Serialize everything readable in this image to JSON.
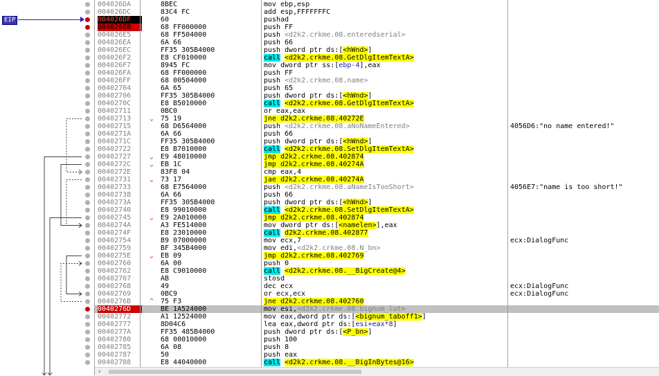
{
  "eip_label": "EIP",
  "scroll_left_icon": "‹",
  "rows": [
    {
      "addr": "004026DA",
      "bytes": "8BEC",
      "instr": [
        {
          "t": "mov ebp,esp"
        }
      ],
      "comment": ""
    },
    {
      "addr": "004026DC",
      "bytes": "83C4 FC",
      "instr": [
        {
          "t": "add esp,FFFFFFFC"
        }
      ],
      "comment": ""
    },
    {
      "addr": "004026DF",
      "bytes": "60",
      "instr": [
        {
          "t": "pushad"
        }
      ],
      "comment": "",
      "mark": "eip"
    },
    {
      "addr": "004026E0",
      "bytes": "68 FF000000",
      "instr": [
        {
          "t": "push FF"
        }
      ],
      "comment": "",
      "mark": "bp"
    },
    {
      "addr": "004026E5",
      "bytes": "68 FF504000",
      "instr": [
        {
          "t": "push "
        },
        {
          "t": "<d2k2.crkme.08.enteredserial>",
          "c": "gray"
        }
      ],
      "comment": ""
    },
    {
      "addr": "004026EA",
      "bytes": "6A 66",
      "instr": [
        {
          "t": "push 66"
        }
      ],
      "comment": ""
    },
    {
      "addr": "004026EC",
      "bytes": "FF35 305B4000",
      "instr": [
        {
          "t": "push dword ptr ds:["
        },
        {
          "t": "<hWnd>",
          "c": "yellow"
        },
        {
          "t": "]"
        }
      ],
      "comment": ""
    },
    {
      "addr": "004026F2",
      "bytes": "E8 CF010000",
      "instr": [
        {
          "t": "call",
          "c": "cyan"
        },
        {
          "t": " "
        },
        {
          "t": "<d2k2.crkme.08.GetDlgItemTextA>",
          "c": "yellow"
        }
      ],
      "comment": ""
    },
    {
      "addr": "004026F7",
      "bytes": "8945 FC",
      "instr": [
        {
          "t": "mov dword ptr ss:["
        },
        {
          "t": "ebp-4",
          "c": "blue"
        },
        {
          "t": "],eax"
        }
      ],
      "comment": ""
    },
    {
      "addr": "004026FA",
      "bytes": "68 FF000000",
      "instr": [
        {
          "t": "push FF"
        }
      ],
      "comment": ""
    },
    {
      "addr": "004026FF",
      "bytes": "68 00504000",
      "instr": [
        {
          "t": "push "
        },
        {
          "t": "<d2k2.crkme.08.name>",
          "c": "gray"
        }
      ],
      "comment": ""
    },
    {
      "addr": "00402704",
      "bytes": "6A 65",
      "instr": [
        {
          "t": "push 65"
        }
      ],
      "comment": ""
    },
    {
      "addr": "00402706",
      "bytes": "FF35 305B4000",
      "instr": [
        {
          "t": "push dword ptr ds:["
        },
        {
          "t": "<hWnd>",
          "c": "yellow"
        },
        {
          "t": "]"
        }
      ],
      "comment": ""
    },
    {
      "addr": "0040270C",
      "bytes": "E8 B5010000",
      "instr": [
        {
          "t": "call",
          "c": "cyan"
        },
        {
          "t": " "
        },
        {
          "t": "<d2k2.crkme.08.GetDlgItemTextA>",
          "c": "yellow"
        }
      ],
      "comment": ""
    },
    {
      "addr": "00402711",
      "bytes": "0BC0",
      "instr": [
        {
          "t": "or eax,eax"
        }
      ],
      "comment": ""
    },
    {
      "addr": "00402713",
      "bytes": "75 19",
      "instr": [
        {
          "t": "jne d2k2.crkme.08.40272E",
          "c": "yellow"
        }
      ],
      "comment": "",
      "arrow": "⌄"
    },
    {
      "addr": "00402715",
      "bytes": "68 D6564000",
      "instr": [
        {
          "t": "push "
        },
        {
          "t": "<d2k2.crkme.08.aNoNameEntered>",
          "c": "gray"
        }
      ],
      "comment": "4056D6:\"no name entered!\""
    },
    {
      "addr": "0040271A",
      "bytes": "6A 66",
      "instr": [
        {
          "t": "push 66"
        }
      ],
      "comment": ""
    },
    {
      "addr": "0040271C",
      "bytes": "FF35 305B4000",
      "instr": [
        {
          "t": "push dword ptr ds:["
        },
        {
          "t": "<hWnd>",
          "c": "yellow"
        },
        {
          "t": "]"
        }
      ],
      "comment": ""
    },
    {
      "addr": "00402722",
      "bytes": "E8 B7010000",
      "instr": [
        {
          "t": "call",
          "c": "cyan"
        },
        {
          "t": " "
        },
        {
          "t": "<d2k2.crkme.08.SetDlgItemTextA>",
          "c": "yellow"
        }
      ],
      "comment": ""
    },
    {
      "addr": "00402727",
      "bytes": "E9 48010000",
      "instr": [
        {
          "t": "jmp d2k2.crkme.08.402874",
          "c": "yellow"
        }
      ],
      "comment": "",
      "arrow": "⌄"
    },
    {
      "addr": "0040272C",
      "bytes": "EB 1C",
      "instr": [
        {
          "t": "jmp d2k2.crkme.08.40274A",
          "c": "yellow"
        }
      ],
      "comment": "",
      "arrow": "⌄"
    },
    {
      "addr": "0040272E",
      "bytes": "83F8 04",
      "instr": [
        {
          "t": "cmp eax,4"
        }
      ],
      "comment": ""
    },
    {
      "addr": "00402731",
      "bytes": "73 17",
      "instr": [
        {
          "t": "jae d2k2.crkme.08.40274A",
          "c": "yellow"
        }
      ],
      "comment": "",
      "arrow": "⌄"
    },
    {
      "addr": "00402733",
      "bytes": "68 E7564000",
      "instr": [
        {
          "t": "push "
        },
        {
          "t": "<d2k2.crkme.08.aNameIsTooShort>",
          "c": "gray"
        }
      ],
      "comment": "4056E7:\"name is too short!\""
    },
    {
      "addr": "00402738",
      "bytes": "6A 66",
      "instr": [
        {
          "t": "push 66"
        }
      ],
      "comment": ""
    },
    {
      "addr": "0040273A",
      "bytes": "FF35 305B4000",
      "instr": [
        {
          "t": "push dword ptr ds:["
        },
        {
          "t": "<hWnd>",
          "c": "yellow"
        },
        {
          "t": "]"
        }
      ],
      "comment": ""
    },
    {
      "addr": "00402740",
      "bytes": "E8 99010000",
      "instr": [
        {
          "t": "call",
          "c": "cyan"
        },
        {
          "t": " "
        },
        {
          "t": "<d2k2.crkme.08.SetDlgItemTextA>",
          "c": "yellow"
        }
      ],
      "comment": ""
    },
    {
      "addr": "00402745",
      "bytes": "E9 2A010000",
      "instr": [
        {
          "t": "jmp d2k2.crkme.08.402874",
          "c": "yellow"
        }
      ],
      "comment": "",
      "arrow": "⌄"
    },
    {
      "addr": "0040274A",
      "bytes": "A3 FE514000",
      "instr": [
        {
          "t": "mov dword ptr ds:["
        },
        {
          "t": "<namelen>",
          "c": "yellow"
        },
        {
          "t": "],eax"
        }
      ],
      "comment": ""
    },
    {
      "addr": "0040274F",
      "bytes": "E8 23010000",
      "instr": [
        {
          "t": "call",
          "c": "cyan"
        },
        {
          "t": " "
        },
        {
          "t": "d2k2.crkme.08.402877",
          "c": "yellow"
        }
      ],
      "comment": ""
    },
    {
      "addr": "00402754",
      "bytes": "B9 07000000",
      "instr": [
        {
          "t": "mov ecx,7"
        }
      ],
      "comment": "ecx:DialogFunc"
    },
    {
      "addr": "00402759",
      "bytes": "BF 345B4000",
      "instr": [
        {
          "t": "mov edi,"
        },
        {
          "t": "<d2k2.crkme.08.N_bn>",
          "c": "gray"
        }
      ],
      "comment": ""
    },
    {
      "addr": "0040275E",
      "bytes": "EB 09",
      "instr": [
        {
          "t": "jmp d2k2.crkme.08.402769",
          "c": "yellow"
        }
      ],
      "comment": "",
      "arrow": "⌄"
    },
    {
      "addr": "00402760",
      "bytes": "6A 00",
      "instr": [
        {
          "t": "push 0"
        }
      ],
      "comment": ""
    },
    {
      "addr": "00402762",
      "bytes": "E8 C9010000",
      "instr": [
        {
          "t": "call",
          "c": "cyan"
        },
        {
          "t": " "
        },
        {
          "t": "<d2k2.crkme.08.__BigCreate@4>",
          "c": "yellow"
        }
      ],
      "comment": ""
    },
    {
      "addr": "00402767",
      "bytes": "AB",
      "instr": [
        {
          "t": "stosd"
        }
      ],
      "comment": ""
    },
    {
      "addr": "00402768",
      "bytes": "49",
      "instr": [
        {
          "t": "dec ecx"
        }
      ],
      "comment": "ecx:DialogFunc"
    },
    {
      "addr": "00402769",
      "bytes": "0BC9",
      "instr": [
        {
          "t": "or ecx,ecx"
        }
      ],
      "comment": "ecx:DialogFunc"
    },
    {
      "addr": "0040276B",
      "bytes": "75 F3",
      "instr": [
        {
          "t": "jne d2k2.crkme.08.402760",
          "c": "yellow"
        }
      ],
      "comment": "",
      "arrow": "^"
    },
    {
      "addr": "0040276D",
      "bytes": "BE 1A524000",
      "instr": [
        {
          "t": "mov esi,"
        },
        {
          "t": "<d2k2.crkme.08.bignum_lut>",
          "c": "gray"
        }
      ],
      "comment": "",
      "mark": "bp",
      "selected": true
    },
    {
      "addr": "00402772",
      "bytes": "A1 12524000",
      "instr": [
        {
          "t": "mov eax,dword ptr ds:["
        },
        {
          "t": "<bignum_taboff1>",
          "c": "yellow"
        },
        {
          "t": "]"
        }
      ],
      "comment": ""
    },
    {
      "addr": "00402777",
      "bytes": "8D04C6",
      "instr": [
        {
          "t": "lea eax,dword ptr ds:["
        },
        {
          "t": "esi+eax*8",
          "c": "blue"
        },
        {
          "t": "]"
        }
      ],
      "comment": ""
    },
    {
      "addr": "0040277A",
      "bytes": "FF35 485B4000",
      "instr": [
        {
          "t": "push dword ptr ds:["
        },
        {
          "t": "<P_bn>",
          "c": "yellow"
        },
        {
          "t": "]"
        }
      ],
      "comment": ""
    },
    {
      "addr": "00402780",
      "bytes": "68 00010000",
      "instr": [
        {
          "t": "push 100"
        }
      ],
      "comment": ""
    },
    {
      "addr": "00402785",
      "bytes": "6A 08",
      "instr": [
        {
          "t": "push 8"
        }
      ],
      "comment": ""
    },
    {
      "addr": "00402787",
      "bytes": "50",
      "instr": [
        {
          "t": "push eax"
        }
      ],
      "comment": ""
    },
    {
      "addr": "00402788",
      "bytes": "E8 44040000",
      "instr": [
        {
          "t": "call",
          "c": "cyan"
        },
        {
          "t": " "
        },
        {
          "t": "<d2k2.crkme.08.__BigInBytes@16>",
          "c": "yellow"
        }
      ],
      "comment": ""
    }
  ]
}
